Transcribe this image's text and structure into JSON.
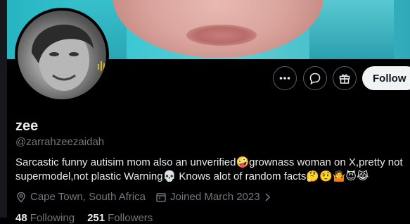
{
  "profile": {
    "name": "zee",
    "handle": "@zarrahzeezaidah",
    "bio_line1_a": "Sarcastic funny autisim mom also an unverified",
    "bio_line1_b": "grownass woman on X,pretty not",
    "bio_line2_a": "supermodel,not plastic Warning",
    "bio_line2_b": " Knows alot of random facts",
    "location": "Cape Town, South Africa",
    "joined": "Joined March 2023",
    "following_count": "48",
    "following_label": "Following",
    "followers_count": "251",
    "followers_label": "Followers"
  },
  "actions": {
    "follow_label": "Follow",
    "more_icon": "more-icon",
    "message_icon": "message-icon",
    "gift_icon": "gift-icon"
  },
  "emojis": {
    "after_unverified": "🤪",
    "after_warning": "💀",
    "end": [
      "🤔",
      "🤨",
      "🤷",
      "😈",
      "😹"
    ]
  },
  "colors": {
    "background": "#000000",
    "text": "#e7e9ea",
    "muted": "#71767b",
    "follow_bg": "#eff3f4",
    "banner_accent": "#3cc7d2"
  }
}
